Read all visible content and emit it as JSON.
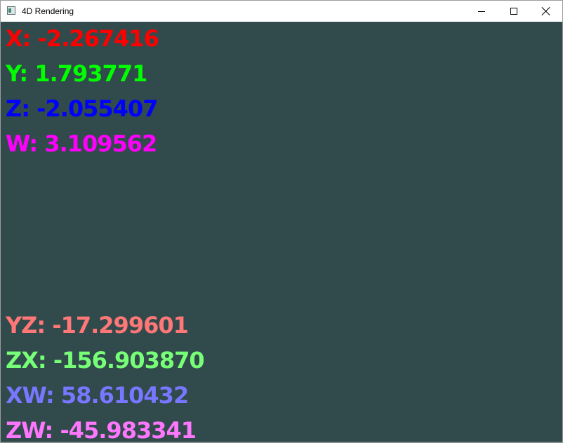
{
  "window": {
    "title": "4D Rendering",
    "icon": "app-window-icon"
  },
  "colors": {
    "canvas_background": "#314a4b",
    "x": "#ff0000",
    "y": "#00ff00",
    "z": "#0000ff",
    "w": "#ff00ff",
    "yz": "#ff7777",
    "zx": "#77ff77",
    "xw": "#7777ff",
    "zw": "#ff77ff"
  },
  "position": {
    "x": "X: -2.267416",
    "y": "Y: 1.793771",
    "z": "Z: -2.055407",
    "w": "W: 3.109562"
  },
  "rotation": {
    "yz": "YZ: -17.299601",
    "zx": "ZX: -156.903870",
    "xw": "XW: 58.610432",
    "zw": "ZW: -45.983341"
  }
}
